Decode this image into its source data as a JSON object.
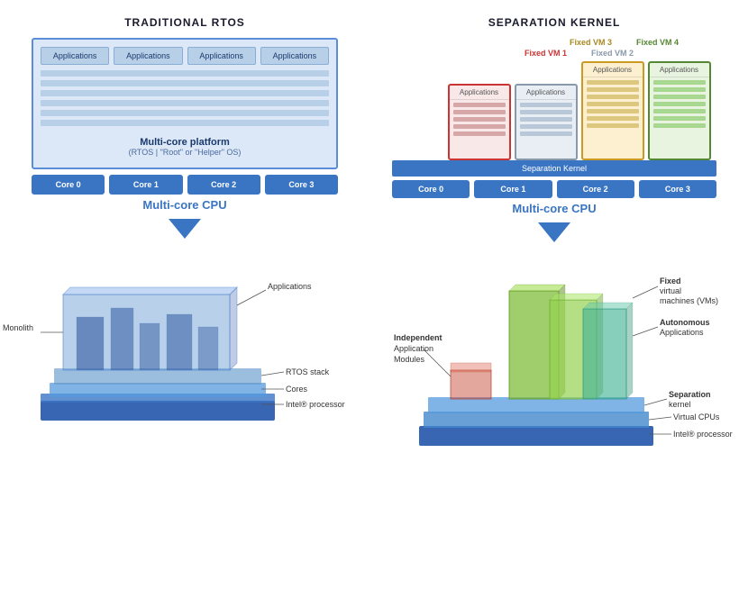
{
  "left": {
    "title": "TRADITIONAL RTOS",
    "apps": [
      "Applications",
      "Applications",
      "Applications",
      "Applications"
    ],
    "platform": {
      "label": "Multi-core platform",
      "sublabel": "(RTOS | \"Root\" or \"Helper\" OS)"
    },
    "cores": [
      "Core 0",
      "Core 1",
      "Core 2",
      "Core 3"
    ],
    "cpu_label": "Multi-core CPU",
    "illustration": {
      "monolith_label": "Monolith",
      "applications_label": "Applications",
      "rtos_stack_label": "RTOS stack",
      "cores_label": "Cores",
      "intel_label": "Intel® processor"
    }
  },
  "right": {
    "title": "SEPARATION KERNEL",
    "vm_top_labels": [
      "Fixed VM 3",
      "Fixed VM 4"
    ],
    "vm_labels": [
      "Fixed VM 1",
      "Fixed VM 2",
      "Fixed VM 3",
      "Fixed VM 4"
    ],
    "vm_apps": [
      "Applications",
      "Applications",
      "Applications",
      "Applications"
    ],
    "sk_bar_label": "Separation Kernel",
    "cores": [
      "Core 0",
      "Core 1",
      "Core 2",
      "Core 3"
    ],
    "cpu_label": "Multi-core CPU",
    "illustration": {
      "fixed_vm_label": "Fixed virtual",
      "fixed_vm_label2": "machines (VMs)",
      "autonomous_label": "Autonomous",
      "autonomous_label2": "Applications",
      "independent_label": "Independent",
      "independent_label2": "Application",
      "independent_label3": "Modules",
      "sk_label": "Separation",
      "sk_label2": "kernel",
      "vcpu_label": "Virtual CPUs",
      "intel_label": "Intel® processor"
    }
  }
}
